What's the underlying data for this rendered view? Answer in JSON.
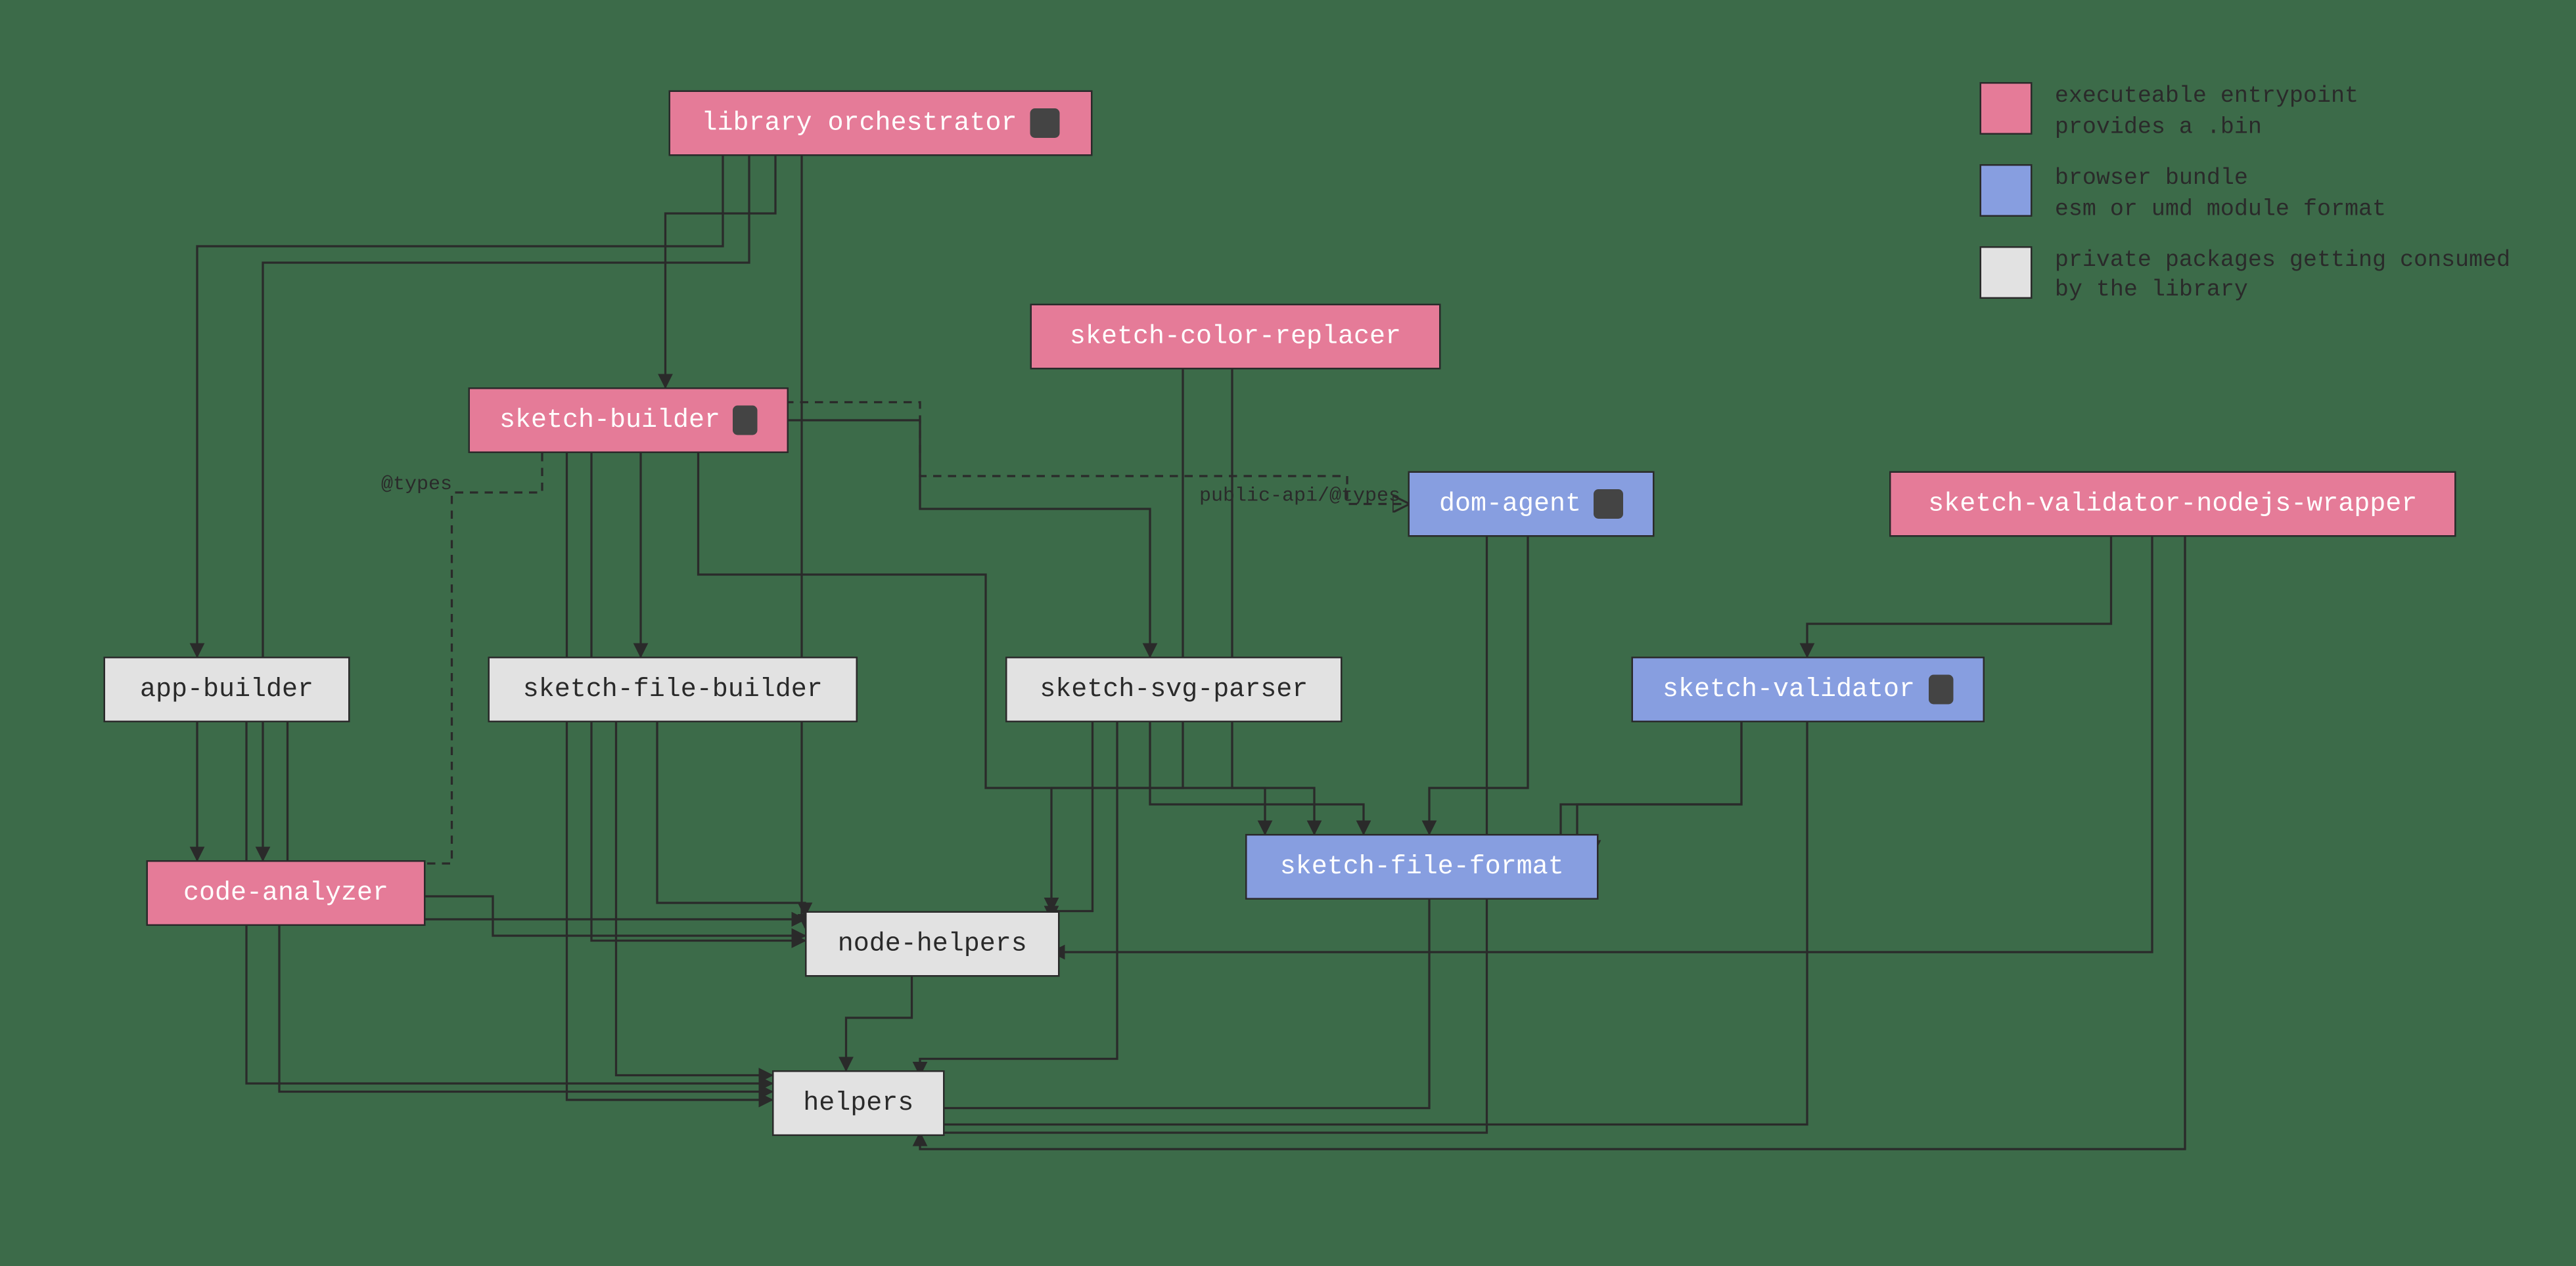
{
  "legend": {
    "pink": "executeable entrypoint\nprovides a .bin",
    "blue": "browser bundle\nesm or umd module format",
    "gray": "private packages getting consumed\nby the library"
  },
  "edgeLabels": {
    "types": "@types",
    "publicApi": "public-api/@types"
  },
  "nodes": {
    "orchestrator": "library orchestrator",
    "colorReplacer": "sketch-color-replacer",
    "sketchBuilder": "sketch-builder",
    "domAgent": "dom-agent",
    "validatorNode": "sketch-validator-nodejs-wrapper",
    "appBuilder": "app-builder",
    "fileBuilder": "sketch-file-builder",
    "svgParser": "sketch-svg-parser",
    "sketchValidator": "sketch-validator",
    "codeAnalyzer": "code-analyzer",
    "fileFormat": "sketch-file-format",
    "nodeHelpers": "node-helpers",
    "helpers": "helpers"
  },
  "chart_data": {
    "type": "graph",
    "node_types": {
      "executable_entrypoint": [
        "library orchestrator",
        "sketch-color-replacer",
        "sketch-builder",
        "sketch-validator-nodejs-wrapper",
        "code-analyzer"
      ],
      "browser_bundle": [
        "dom-agent",
        "sketch-validator",
        "sketch-file-format"
      ],
      "private_package": [
        "app-builder",
        "sketch-file-builder",
        "sketch-svg-parser",
        "node-helpers",
        "helpers"
      ]
    },
    "edges_solid": [
      [
        "library orchestrator",
        "app-builder"
      ],
      [
        "library orchestrator",
        "sketch-builder"
      ],
      [
        "library orchestrator",
        "code-analyzer"
      ],
      [
        "library orchestrator",
        "node-helpers"
      ],
      [
        "sketch-color-replacer",
        "sketch-file-format"
      ],
      [
        "sketch-color-replacer",
        "node-helpers"
      ],
      [
        "sketch-builder",
        "sketch-file-builder"
      ],
      [
        "sketch-builder",
        "sketch-svg-parser"
      ],
      [
        "sketch-builder",
        "sketch-file-format"
      ],
      [
        "sketch-builder",
        "node-helpers"
      ],
      [
        "sketch-builder",
        "helpers"
      ],
      [
        "dom-agent",
        "sketch-file-format"
      ],
      [
        "dom-agent",
        "helpers"
      ],
      [
        "sketch-validator-nodejs-wrapper",
        "sketch-validator"
      ],
      [
        "sketch-validator-nodejs-wrapper",
        "node-helpers"
      ],
      [
        "sketch-validator-nodejs-wrapper",
        "helpers"
      ],
      [
        "app-builder",
        "code-analyzer"
      ],
      [
        "app-builder",
        "node-helpers"
      ],
      [
        "app-builder",
        "helpers"
      ],
      [
        "sketch-file-builder",
        "node-helpers"
      ],
      [
        "sketch-file-builder",
        "helpers"
      ],
      [
        "sketch-svg-parser",
        "sketch-file-format"
      ],
      [
        "sketch-svg-parser",
        "node-helpers"
      ],
      [
        "sketch-svg-parser",
        "helpers"
      ],
      [
        "sketch-validator",
        "sketch-file-format"
      ],
      [
        "sketch-validator",
        "helpers"
      ],
      [
        "code-analyzer",
        "node-helpers"
      ],
      [
        "code-analyzer",
        "helpers"
      ],
      [
        "sketch-file-format",
        "helpers"
      ],
      [
        "node-helpers",
        "helpers"
      ]
    ],
    "edges_dashed": [
      {
        "from": "sketch-builder",
        "to": "code-analyzer",
        "label": "@types"
      },
      {
        "from": "sketch-builder",
        "to": "dom-agent",
        "label": "public-api/@types"
      }
    ]
  }
}
